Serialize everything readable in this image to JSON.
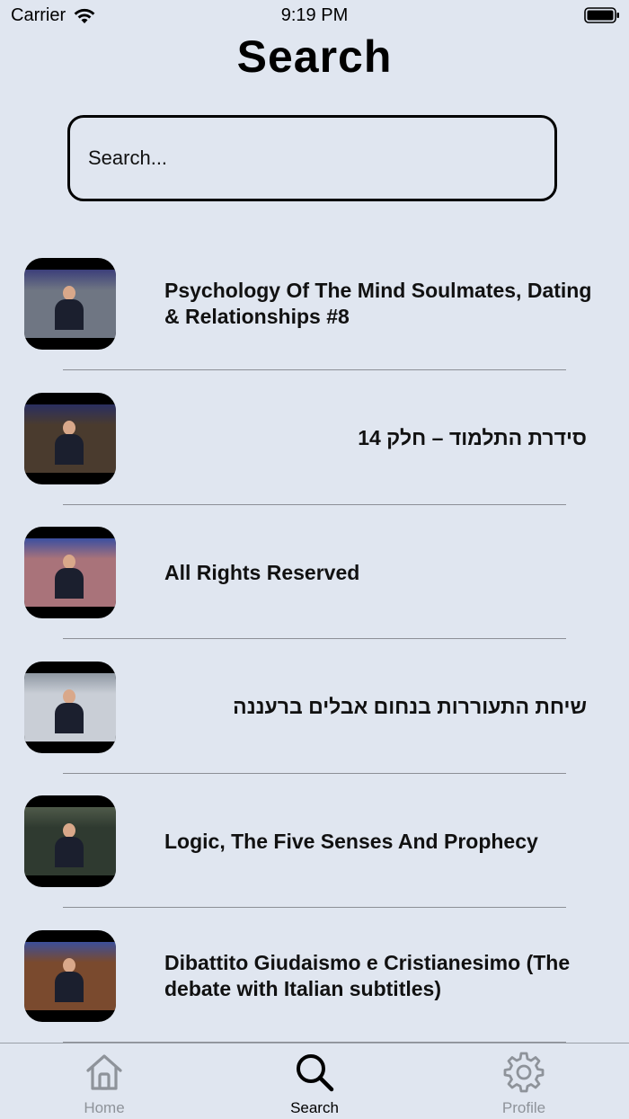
{
  "status_bar": {
    "carrier": "Carrier",
    "time": "9:19 PM"
  },
  "header": {
    "title": "Search"
  },
  "search": {
    "placeholder": "Search...",
    "value": ""
  },
  "results": [
    {
      "title": "Psychology Of The Mind   Soulmates, Dating & Relationships #8",
      "dir": "ltr",
      "thumb_bg": "#6f7683",
      "thumb_accent": "#3c3f7a"
    },
    {
      "title": "סידרת התלמוד – חלק 14",
      "dir": "rtl",
      "thumb_bg": "#4a3b2e",
      "thumb_accent": "#2a2f60"
    },
    {
      "title": "All Rights Reserved",
      "dir": "ltr",
      "thumb_bg": "#a9737a",
      "thumb_accent": "#3b4fa0"
    },
    {
      "title": "שיחת התעוררות בנחום אבלים ברעננה",
      "dir": "rtl",
      "thumb_bg": "#c9ced6",
      "thumb_accent": "#8f98a3"
    },
    {
      "title": "Logic, The Five Senses And Prophecy",
      "dir": "ltr",
      "thumb_bg": "#2f3a30",
      "thumb_accent": "#4f5a4a"
    },
    {
      "title": "Dibattito Giudaismo e Cristianesimo (The debate with Italian subtitles)",
      "dir": "ltr",
      "thumb_bg": "#7a4a2e",
      "thumb_accent": "#3c4f9a"
    }
  ],
  "tab_bar": {
    "tabs": [
      {
        "label": "Home",
        "icon": "house-icon",
        "active": false
      },
      {
        "label": "Search",
        "icon": "magnifier-icon",
        "active": true
      },
      {
        "label": "Profile",
        "icon": "gear-icon",
        "active": false
      }
    ]
  },
  "colors": {
    "background": "#e0e6f0",
    "inactive_tab": "#8e939a",
    "active_tab": "#000000",
    "divider": "#8c8f96"
  }
}
